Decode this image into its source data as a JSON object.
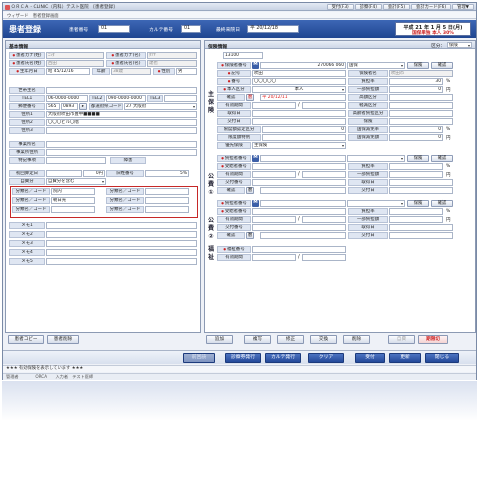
{
  "window": {
    "title": "ＯＲＣＡ - CLINIC（内科）テスト医院　[患者登録]"
  },
  "top_buttons": [
    "受付(F3)",
    "診察(F4)",
    "会計(F5)",
    "会計カード(F6)",
    "管理▼"
  ],
  "wizard": {
    "text": "ウィザード　患者登録画面"
  },
  "header": {
    "title": "患者登録",
    "patient_no_label": "患者番号",
    "patient_no": "01",
    "card_no_label": "カルテ番号",
    "card_no": "01",
    "last_visit_label": "最終来院日",
    "last_visit": "平 20/12/18",
    "date_line": "平成 21 年 1 月 5 日(月)",
    "insurance_line": "国保単独 本人 30%"
  },
  "basic": {
    "heading": "基本情報",
    "name_kana_sei_label": "患者カナ(姓)",
    "name_kana_sei": "ﾆｼﾀ",
    "name_kana_mei_label": "患者カナ(名)",
    "name_kana_mei": "ﾀﾂﾔ",
    "name_kanji_sei_label": "患者氏名(姓)",
    "name_kanji_sei": "西田",
    "name_kanji_mei_label": "患者氏名(名)",
    "name_kanji_mei": "達也",
    "birth_label": "生年月日",
    "birth": "昭 45/12/16",
    "age_label": "年齢",
    "age": "38歳",
    "sex_label": "性別",
    "sex": "男",
    "household_label": "世帯主名",
    "tel1_label": "TEL1",
    "tel1": "06-0000-0000",
    "tel2_label": "TEL2",
    "tel2": "090-0000-0000",
    "tel3_label": "TEL3",
    "zip_label": "郵便番号",
    "zip": "565",
    "zip2": "0893",
    "zip_btn": "",
    "pref_label": "都道府県コード",
    "pref": "27 大阪府",
    "addr1_label": "住所1",
    "addr1": "大阪府吹田市豊中■■■■",
    "addr2_label": "住所2",
    "addr2": "〇〇〇ビル〇階",
    "addr3_label": "住所3",
    "office_label": "事業所名",
    "office_addr_label": "事業所住所",
    "note_label": "特記事項",
    "rehab_label": "障害",
    "first_visit_label": "初回算定日",
    "kokuho_label": "国保",
    "tax_label": "旧姓",
    "tax": "0円",
    "tax2_label": "旧姓番号",
    "tax2": "",
    "percent": "5%",
    "discount_label": "自費分",
    "discount": "自費分を含む",
    "classify_rows": [
      {
        "l1": "分類名／コード",
        "v1": "院内",
        "l2": "分類名／コード",
        "v2": ""
      },
      {
        "l1": "分類名／コード",
        "v1": "朝日光",
        "l2": "分類名／コード",
        "v2": ""
      },
      {
        "l1": "分類名／コード",
        "v1": "",
        "l2": "分類名／コード",
        "v2": ""
      }
    ],
    "memo_labels": [
      "メモ1",
      "メモ2",
      "メモ3",
      "メモ4",
      "メモ5"
    ]
  },
  "insurance": {
    "heading": "保険情報",
    "kubun_label": "区分：",
    "kubun": "保険",
    "code": "13100",
    "side_main": "主保険",
    "side_k1": "公費①",
    "side_k2": "公費②",
    "side_welfare": "福祉",
    "ins_no_label": "保険者番号",
    "ins_no": "270066 060",
    "ins_type": "国保",
    "ins_name_label": "保険者名",
    "ins_name": "吹田市",
    "kigo_label": "記号",
    "kigo": "吹田",
    "bango_label": "番号",
    "bango": "〇〇〇〇〇",
    "futan_label": "負担率",
    "futan": "30",
    "honnin_label": "本人区分",
    "honnin": "本人",
    "ichibu_label": "一部負担額",
    "ichibu": "0",
    "kakunin_label": "確認",
    "kakunin": "平 20/12/11",
    "kodo_label": "高額区分",
    "yuko_label": "有効期間",
    "genmen_label": "軽減区分",
    "shutoku_label": "取得日",
    "kogaku_label": "高齢者負担区分",
    "kofu_label": "交付日",
    "hoken_label": "保険",
    "ref_label": "限度額認定区分",
    "ref_val": "0",
    "kokuhen_label": "国保減免区分",
    "genmen_rate_label": "国保減免率",
    "genmen_rate": "0",
    "kikan_label": "限度額特例",
    "genmen_amt_label": "国保減免額",
    "genmen_amt": "0",
    "yusen_label": "優先保険",
    "yusen": "主保険",
    "k_no_label": "負担者番号",
    "k_recv_label": "受給者番号",
    "k_futan_label": "負担率",
    "k_yuko_label": "有効期間",
    "k_ichibu_label": "一部負担額",
    "k_kofu_label": "交付番号",
    "k_shutoku_label": "取得日",
    "k_kakunin_label": "確認",
    "k_kofu2_label": "交付日",
    "w_no_label": "福祉番号",
    "w_yuko_label": "有効期間",
    "percent_unit": "%",
    "yen_unit": "円",
    "btn_hoken": "保険",
    "btn_kakunin": "確認",
    "btn_ming": "M",
    "btn_cal": "暦"
  },
  "bottom_left": [
    "患者コピー",
    "患者削除"
  ],
  "bottom_mid": [
    "追加",
    "複写",
    "修正",
    "交換",
    "削除",
    "自費",
    "期限切"
  ],
  "dock": [
    "前回読",
    "診察券発行",
    "カルテ発行",
    "クリア",
    "受付",
    "更新",
    "閉じる"
  ],
  "status_text": "★★★ 有効保険を表示しています ★★★",
  "status2_text": "管理者　　　　ORCA　　入力者　テスト医師"
}
